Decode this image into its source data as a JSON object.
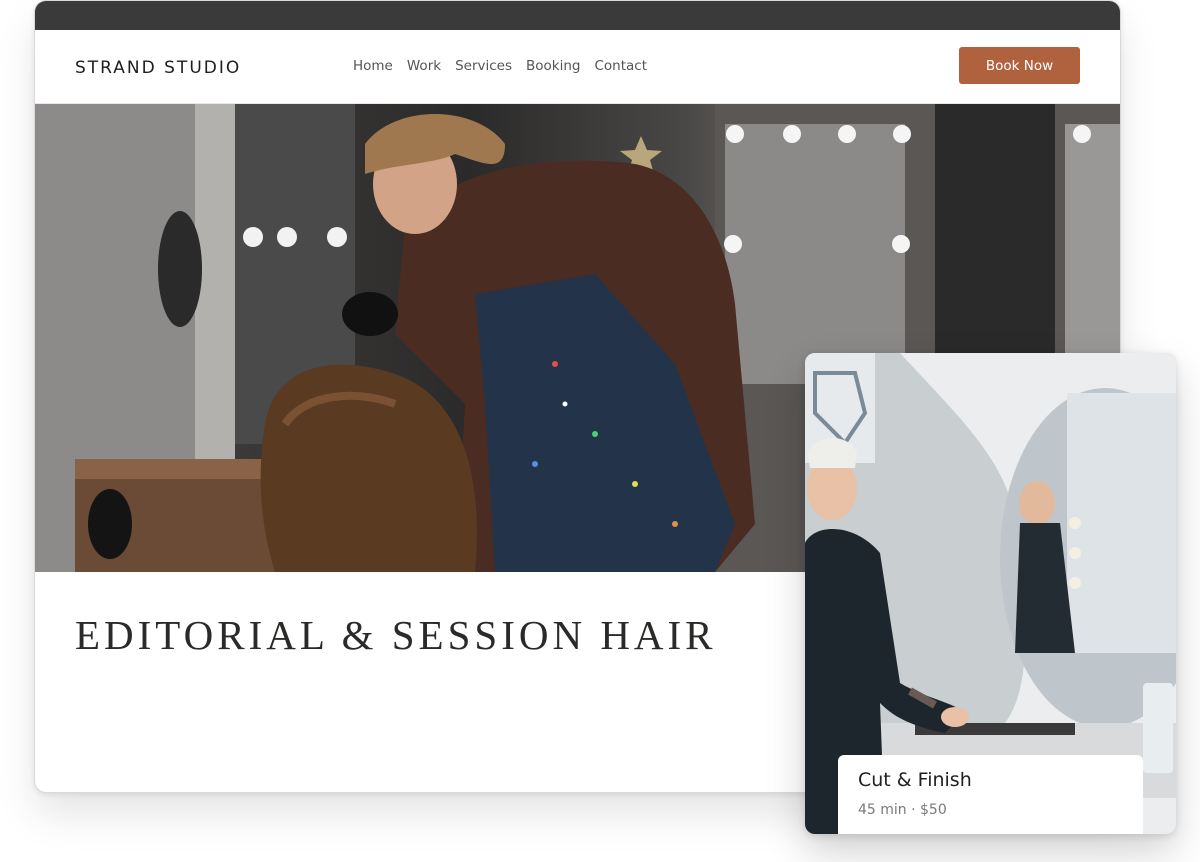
{
  "header": {
    "brand": "STRAND STUDIO",
    "nav": [
      "Home",
      "Work",
      "Services",
      "Booking",
      "Contact"
    ],
    "cta_label": "Book Now"
  },
  "hero": {
    "heading": "EDITORIAL & SESSION HAIR"
  },
  "card": {
    "title": "Cut & Finish",
    "meta": "45 min · $50"
  },
  "colors": {
    "accent": "#b0623e",
    "titlebar": "#3a3a3a",
    "heading": "#2b2a28"
  }
}
